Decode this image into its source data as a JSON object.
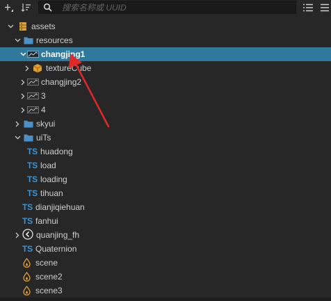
{
  "search": {
    "placeholder": "搜索名称或 UUID"
  },
  "toolbar_icons": {
    "add": "plus-icon",
    "sort": "sort-icon",
    "search": "search-icon",
    "list": "list-view-icon",
    "menu": "menu-icon"
  },
  "colors": {
    "background": "#272727",
    "selected_row": "#2f7a9c",
    "folder": "#4a90c8",
    "typescript": "#3c94d6",
    "scene": "#d99a3a"
  },
  "tree": [
    {
      "label": "assets",
      "icon": "database-icon"
    },
    {
      "label": "resources",
      "icon": "folder-icon"
    },
    {
      "label": "changjing1",
      "icon": "model-icon",
      "selected": true
    },
    {
      "label": "textureCube",
      "icon": "cube-icon"
    },
    {
      "label": "changjing2",
      "icon": "model-icon"
    },
    {
      "label": "3",
      "icon": "model-icon"
    },
    {
      "label": "4",
      "icon": "model-icon"
    },
    {
      "label": "skyui",
      "icon": "folder-icon"
    },
    {
      "label": "uiTs",
      "icon": "folder-icon"
    },
    {
      "label": "huadong",
      "icon": "typescript-icon",
      "icon_text": "TS"
    },
    {
      "label": "load",
      "icon": "typescript-icon",
      "icon_text": "TS"
    },
    {
      "label": "loading",
      "icon": "typescript-icon",
      "icon_text": "TS"
    },
    {
      "label": "tihuan",
      "icon": "typescript-icon",
      "icon_text": "TS"
    },
    {
      "label": "dianjiqiehuan",
      "icon": "typescript-icon",
      "icon_text": "TS"
    },
    {
      "label": "fanhui",
      "icon": "typescript-icon",
      "icon_text": "TS"
    },
    {
      "label": "quanjing_fh",
      "icon": "back-circle-icon"
    },
    {
      "label": "Quaternion",
      "icon": "typescript-icon",
      "icon_text": "TS"
    },
    {
      "label": "scene",
      "icon": "scene-icon"
    },
    {
      "label": "scene2",
      "icon": "scene-icon"
    },
    {
      "label": "scene3",
      "icon": "scene-icon"
    }
  ]
}
